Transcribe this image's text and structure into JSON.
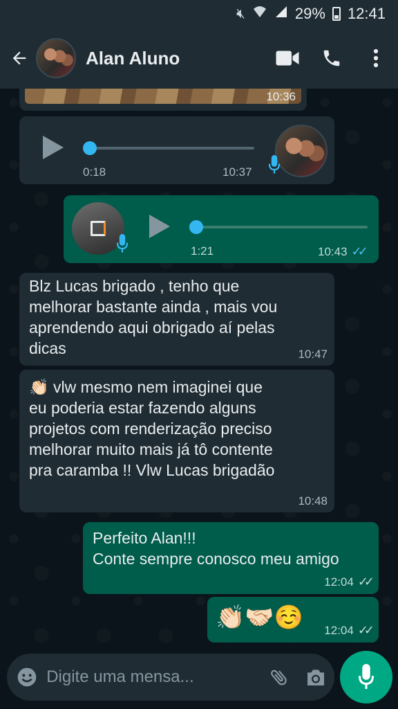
{
  "status_bar": {
    "battery": "29%",
    "time": "12:41"
  },
  "header": {
    "contact_name": "Alan Aluno",
    "icons": [
      "back-arrow-icon",
      "video-call-icon",
      "phone-icon",
      "more-vert-icon"
    ]
  },
  "messages": [
    {
      "type": "image",
      "direction": "in",
      "time": "10:36"
    },
    {
      "type": "voice",
      "direction": "in",
      "duration": "0:18",
      "time": "10:37"
    },
    {
      "type": "voice",
      "direction": "out",
      "duration": "1:21",
      "time": "10:43",
      "status": "read"
    },
    {
      "type": "text",
      "direction": "in",
      "text": "Blz Lucas brigado , tenho que\nmelhorar bastante ainda , mais vou\naprendendo aqui obrigado aí pelas\ndicas",
      "time": "10:47"
    },
    {
      "type": "text",
      "direction": "in",
      "text": "👏🏻 vlw mesmo nem imaginei que\neu poderia estar fazendo alguns\nprojetos com renderização preciso\nmelhorar muito mais já tô contente\npra caramba !! Vlw Lucas brigadão",
      "time": "10:48"
    },
    {
      "type": "text",
      "direction": "out",
      "text": "Perfeito Alan!!!\nConte sempre conosco meu amigo",
      "time": "12:04",
      "status": "delivered"
    },
    {
      "type": "emoji",
      "direction": "out",
      "text": "👏🏻🤝🏻☺️",
      "time": "12:04",
      "status": "delivered"
    }
  ],
  "composer": {
    "placeholder": "Digite uma mensa...",
    "icons": [
      "emoji-icon",
      "attach-icon",
      "camera-icon",
      "mic-icon"
    ]
  },
  "colors": {
    "header_bg": "#1f2c33",
    "chat_bg": "#0b141a",
    "incoming_bubble": "#1f2c33",
    "outgoing_bubble": "#005c4b",
    "accent": "#00a884",
    "read_tick": "#53bdeb",
    "voice_knob": "#34b7f1"
  }
}
